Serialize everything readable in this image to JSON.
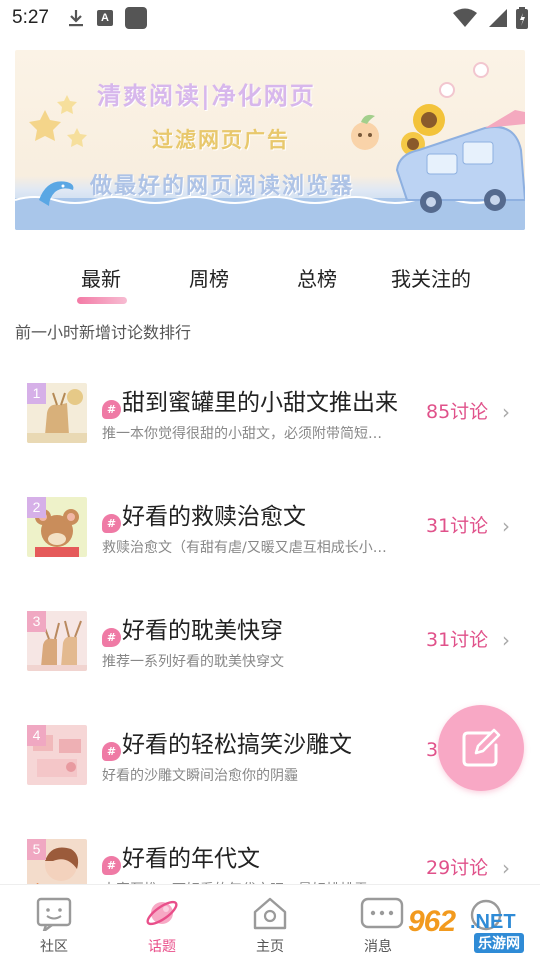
{
  "status_bar": {
    "time": "5:27",
    "a_badge": "A"
  },
  "banner": {
    "line1": "清爽阅读|净化网页",
    "line2": "过滤网页广告",
    "line3": "做最好的网页阅读浏览器"
  },
  "tabs": [
    {
      "label": "最新",
      "active": true
    },
    {
      "label": "周榜",
      "active": false
    },
    {
      "label": "总榜",
      "active": false
    },
    {
      "label": "我关注的",
      "active": false
    }
  ],
  "subtitle": "前一小时新增讨论数排行",
  "hash_symbol": "#",
  "topics": [
    {
      "rank": "1",
      "title": "甜到蜜罐里的小甜文推出来",
      "desc": "推一本你觉得很甜的小甜文，必须附带简短…",
      "count": "85讨论",
      "rank_color": "#d6b0e8"
    },
    {
      "rank": "2",
      "title": "好看的救赎治愈文",
      "desc": "救赎治愈文（有甜有虐/又暖又虐互相成长小…",
      "count": "31讨论",
      "rank_color": "#d6b0e8"
    },
    {
      "rank": "3",
      "title": "好看的耽美快穿",
      "desc": "推荐一系列好看的耽美快穿文",
      "count": "31讨论",
      "rank_color": "#f0a8c2"
    },
    {
      "rank": "4",
      "title": "好看的轻松搞笑沙雕文",
      "desc": "好看的沙雕文瞬间治愈你的阴霾",
      "count": "3",
      "rank_color": "#f0a8c2"
    },
    {
      "rank": "5",
      "title": "好看的年代文",
      "desc": "大家互推一下好看的年代文吧，最好排排雷",
      "count": "29讨论",
      "rank_color": "#f0a8c2"
    }
  ],
  "bottom_nav": [
    {
      "label": "社区",
      "icon": "community-icon",
      "active": false
    },
    {
      "label": "话题",
      "icon": "planet-icon",
      "active": true
    },
    {
      "label": "主页",
      "icon": "home-icon",
      "active": false
    },
    {
      "label": "消息",
      "icon": "message-icon",
      "active": false
    }
  ],
  "watermark": {
    "number": "962",
    "domain": ".NET",
    "cn": "乐游网"
  },
  "colors": {
    "accent": "#e0518a",
    "fab": "#f8a8c5",
    "tab_indicator": "#f37ba6"
  }
}
